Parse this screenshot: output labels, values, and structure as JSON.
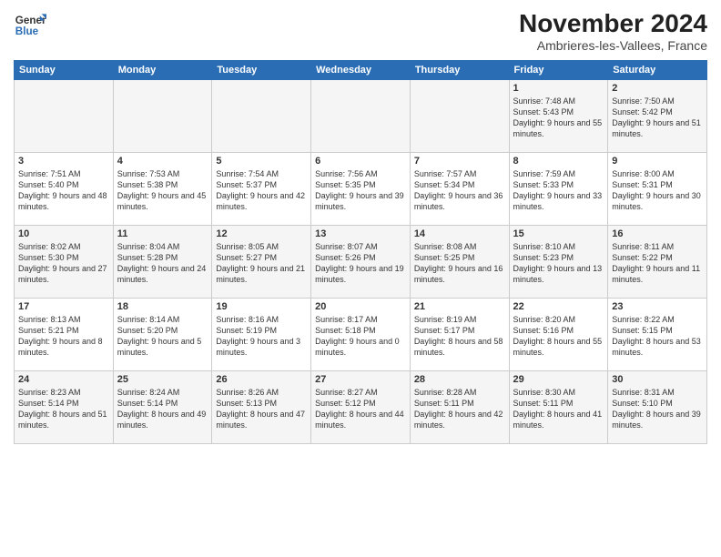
{
  "header": {
    "logo_line1": "General",
    "logo_line2": "Blue",
    "month_year": "November 2024",
    "location": "Ambrieres-les-Vallees, France"
  },
  "weekdays": [
    "Sunday",
    "Monday",
    "Tuesday",
    "Wednesday",
    "Thursday",
    "Friday",
    "Saturday"
  ],
  "weeks": [
    [
      {
        "day": "",
        "empty": true
      },
      {
        "day": "",
        "empty": true
      },
      {
        "day": "",
        "empty": true
      },
      {
        "day": "",
        "empty": true
      },
      {
        "day": "",
        "empty": true
      },
      {
        "day": "1",
        "sunrise": "7:48 AM",
        "sunset": "5:43 PM",
        "daylight": "9 hours and 55 minutes."
      },
      {
        "day": "2",
        "sunrise": "7:50 AM",
        "sunset": "5:42 PM",
        "daylight": "9 hours and 51 minutes."
      }
    ],
    [
      {
        "day": "3",
        "sunrise": "7:51 AM",
        "sunset": "5:40 PM",
        "daylight": "9 hours and 48 minutes."
      },
      {
        "day": "4",
        "sunrise": "7:53 AM",
        "sunset": "5:38 PM",
        "daylight": "9 hours and 45 minutes."
      },
      {
        "day": "5",
        "sunrise": "7:54 AM",
        "sunset": "5:37 PM",
        "daylight": "9 hours and 42 minutes."
      },
      {
        "day": "6",
        "sunrise": "7:56 AM",
        "sunset": "5:35 PM",
        "daylight": "9 hours and 39 minutes."
      },
      {
        "day": "7",
        "sunrise": "7:57 AM",
        "sunset": "5:34 PM",
        "daylight": "9 hours and 36 minutes."
      },
      {
        "day": "8",
        "sunrise": "7:59 AM",
        "sunset": "5:33 PM",
        "daylight": "9 hours and 33 minutes."
      },
      {
        "day": "9",
        "sunrise": "8:00 AM",
        "sunset": "5:31 PM",
        "daylight": "9 hours and 30 minutes."
      }
    ],
    [
      {
        "day": "10",
        "sunrise": "8:02 AM",
        "sunset": "5:30 PM",
        "daylight": "9 hours and 27 minutes."
      },
      {
        "day": "11",
        "sunrise": "8:04 AM",
        "sunset": "5:28 PM",
        "daylight": "9 hours and 24 minutes."
      },
      {
        "day": "12",
        "sunrise": "8:05 AM",
        "sunset": "5:27 PM",
        "daylight": "9 hours and 21 minutes."
      },
      {
        "day": "13",
        "sunrise": "8:07 AM",
        "sunset": "5:26 PM",
        "daylight": "9 hours and 19 minutes."
      },
      {
        "day": "14",
        "sunrise": "8:08 AM",
        "sunset": "5:25 PM",
        "daylight": "9 hours and 16 minutes."
      },
      {
        "day": "15",
        "sunrise": "8:10 AM",
        "sunset": "5:23 PM",
        "daylight": "9 hours and 13 minutes."
      },
      {
        "day": "16",
        "sunrise": "8:11 AM",
        "sunset": "5:22 PM",
        "daylight": "9 hours and 11 minutes."
      }
    ],
    [
      {
        "day": "17",
        "sunrise": "8:13 AM",
        "sunset": "5:21 PM",
        "daylight": "9 hours and 8 minutes."
      },
      {
        "day": "18",
        "sunrise": "8:14 AM",
        "sunset": "5:20 PM",
        "daylight": "9 hours and 5 minutes."
      },
      {
        "day": "19",
        "sunrise": "8:16 AM",
        "sunset": "5:19 PM",
        "daylight": "9 hours and 3 minutes."
      },
      {
        "day": "20",
        "sunrise": "8:17 AM",
        "sunset": "5:18 PM",
        "daylight": "9 hours and 0 minutes."
      },
      {
        "day": "21",
        "sunrise": "8:19 AM",
        "sunset": "5:17 PM",
        "daylight": "8 hours and 58 minutes."
      },
      {
        "day": "22",
        "sunrise": "8:20 AM",
        "sunset": "5:16 PM",
        "daylight": "8 hours and 55 minutes."
      },
      {
        "day": "23",
        "sunrise": "8:22 AM",
        "sunset": "5:15 PM",
        "daylight": "8 hours and 53 minutes."
      }
    ],
    [
      {
        "day": "24",
        "sunrise": "8:23 AM",
        "sunset": "5:14 PM",
        "daylight": "8 hours and 51 minutes."
      },
      {
        "day": "25",
        "sunrise": "8:24 AM",
        "sunset": "5:14 PM",
        "daylight": "8 hours and 49 minutes."
      },
      {
        "day": "26",
        "sunrise": "8:26 AM",
        "sunset": "5:13 PM",
        "daylight": "8 hours and 47 minutes."
      },
      {
        "day": "27",
        "sunrise": "8:27 AM",
        "sunset": "5:12 PM",
        "daylight": "8 hours and 44 minutes."
      },
      {
        "day": "28",
        "sunrise": "8:28 AM",
        "sunset": "5:11 PM",
        "daylight": "8 hours and 42 minutes."
      },
      {
        "day": "29",
        "sunrise": "8:30 AM",
        "sunset": "5:11 PM",
        "daylight": "8 hours and 41 minutes."
      },
      {
        "day": "30",
        "sunrise": "8:31 AM",
        "sunset": "5:10 PM",
        "daylight": "8 hours and 39 minutes."
      }
    ]
  ]
}
